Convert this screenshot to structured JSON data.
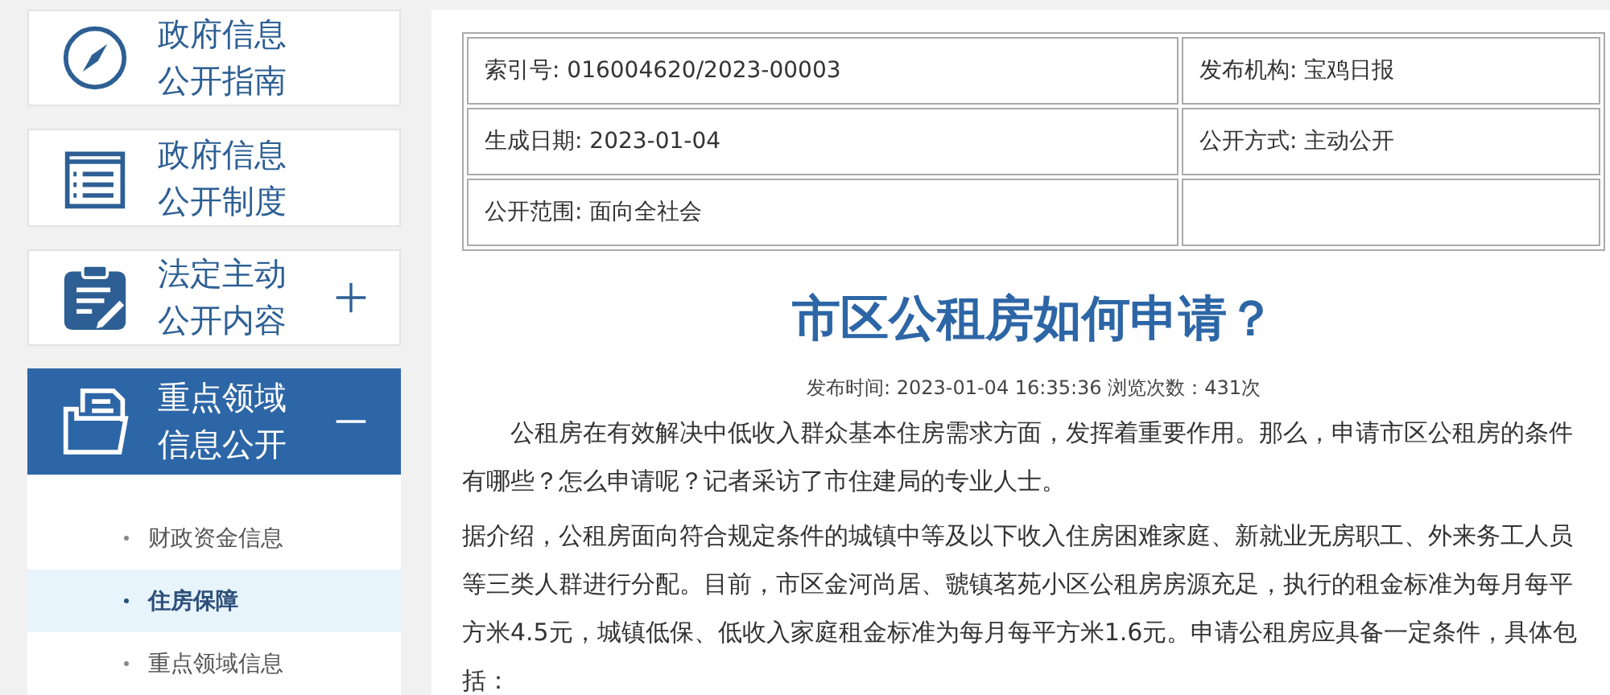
{
  "sidebar": {
    "items": [
      {
        "label_lines": [
          "政府信息",
          "公开指南"
        ],
        "selected": false
      },
      {
        "label_lines": [
          "政府信息",
          "公开制度"
        ],
        "selected": false
      },
      {
        "label_lines": [
          "法定主动",
          "公开内容"
        ],
        "selected": false,
        "expanded": false
      },
      {
        "label_lines": [
          "重点领域",
          "信息公开"
        ],
        "selected": true,
        "expanded": true,
        "children": [
          {
            "label": "财政资金信息",
            "selected": false
          },
          {
            "label": "住房保障",
            "selected": true
          },
          {
            "label": "重点领域信息",
            "selected": false
          }
        ]
      }
    ]
  },
  "info_table": {
    "rows": [
      [
        "索引号: 016004620/2023-00003",
        "发布机构: 宝鸡日报"
      ],
      [
        "生成日期: 2023-01-04",
        "公开方式: 主动公开"
      ],
      [
        "公开范围: 面向全社会",
        null
      ]
    ]
  },
  "article": {
    "title": "市区公租房如何申请？",
    "meta": "发布时间: 2023-01-04 16:35:36 浏览次数：431次",
    "paragraphs": [
      {
        "kind": "indented",
        "text": "公租房在有效解决中低收入群众基本住房需求方面，发挥着重要作用。那么，申请市区公租房的条件有哪些？怎么申请呢？记者采访了市住建局的专业人士。"
      },
      {
        "kind": "plain",
        "text": "据介绍，公租房面向符合规定条件的城镇中等及以下收入住房困难家庭、新就业无房职工、外来务工人员等三类人群进行分配。目前，市区金河尚居、虢镇茗苑小区公租房房源充足，执行的租金标准为每月每平方米4.5元，城镇低保、低收入家庭租金标准为每月每平方米1.6元。申请公租房应具备一定条件，具体包括："
      }
    ]
  }
}
